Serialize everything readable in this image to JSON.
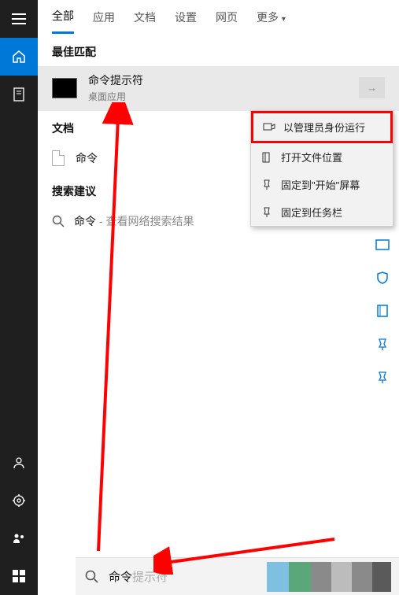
{
  "sidebar": {
    "top": [
      "menu",
      "home",
      "page"
    ],
    "bottom": [
      "user",
      "settings",
      "people",
      "start"
    ]
  },
  "tabs": {
    "items": [
      "全部",
      "应用",
      "文档",
      "设置",
      "网页",
      "更多"
    ],
    "active_index": 0,
    "more_suffix": "▾"
  },
  "best_match": {
    "section": "最佳匹配",
    "title": "命令提示符",
    "subtitle": "桌面应用",
    "arrow": "→"
  },
  "documents": {
    "section": "文档",
    "items": [
      {
        "label": "命令"
      }
    ]
  },
  "suggestions": {
    "section": "搜索建议",
    "items": [
      {
        "query": "命令",
        "rest": " - 查看网络搜索结果",
        "chev": "›"
      }
    ]
  },
  "context_menu": {
    "items": [
      {
        "icon": "admin",
        "label": "以管理员身份运行",
        "highlight": true
      },
      {
        "icon": "folder",
        "label": "打开文件位置",
        "highlight": false
      },
      {
        "icon": "pin-start",
        "label": "固定到\"开始\"屏幕",
        "highlight": false
      },
      {
        "icon": "pin-taskbar",
        "label": "固定到任务栏",
        "highlight": false
      }
    ]
  },
  "search_bar": {
    "typed": "命令",
    "ghost": "提示符"
  },
  "right_icons": [
    "window",
    "shield",
    "book",
    "pin-a",
    "pin-b"
  ],
  "annotation": {
    "arrow1_color": "#ff0000",
    "arrow2_color": "#ff0000"
  }
}
